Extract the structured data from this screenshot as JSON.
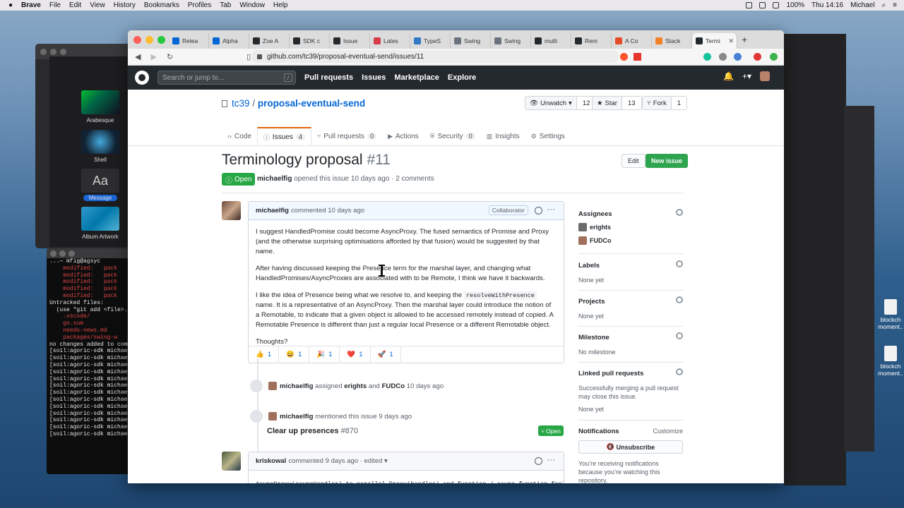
{
  "menubar": {
    "app": "Brave",
    "items": [
      "File",
      "Edit",
      "View",
      "History",
      "Bookmarks",
      "Profiles",
      "Tab",
      "Window",
      "Help"
    ],
    "battery": "100%",
    "clock": "Thu 14:16",
    "user": "Michael"
  },
  "left_window": {
    "thumbs": [
      "Arabesque",
      "Shell",
      "Message",
      "Album Artwork"
    ],
    "aa": "Aa"
  },
  "terminal": {
    "lines": [
      {
        "t": "...— mfig@agsyc",
        "c": "w"
      },
      {
        "t": "    modified:   pack",
        "c": "r"
      },
      {
        "t": "    modified:   pack",
        "c": "r"
      },
      {
        "t": "    modified:   pack",
        "c": "r"
      },
      {
        "t": "    modified:   pack",
        "c": "r"
      },
      {
        "t": "    modified:   pack",
        "c": "r"
      },
      {
        "t": "",
        "c": "w"
      },
      {
        "t": "Untracked files:",
        "c": "w"
      },
      {
        "t": "  (use \"git add <file>...",
        "c": "w"
      },
      {
        "t": "    .vscode/",
        "c": "r"
      },
      {
        "t": "    go.sum",
        "c": "r"
      },
      {
        "t": "    needs-news.md",
        "c": "r"
      },
      {
        "t": "    packages/swing-w",
        "c": "r"
      },
      {
        "t": "",
        "c": "w"
      },
      {
        "t": "no changes added to comm",
        "c": "w"
      },
      {
        "t": "[soil:agoric-sdk michaelf",
        "c": "w"
      },
      {
        "t": "[soil:agoric-sdk michaelf",
        "c": "w"
      },
      {
        "t": "[soil:agoric-sdk michaelf",
        "c": "w"
      },
      {
        "t": "[soil:agoric-sdk michaelf",
        "c": "w"
      },
      {
        "t": "[soil:agoric-sdk michaelf",
        "c": "w"
      },
      {
        "t": "[soil:agoric-sdk michaelf",
        "c": "w"
      },
      {
        "t": "[soil:agoric-sdk michaelf",
        "c": "w"
      },
      {
        "t": "[soil:agoric-sdk michaelf",
        "c": "w"
      },
      {
        "t": "[soil:agoric-sdk michaelf",
        "c": "w"
      },
      {
        "t": "[soil:agoric-sdk michaelf",
        "c": "w"
      },
      {
        "t": "[soil:agoric-sdk michaelf",
        "c": "w"
      },
      {
        "t": "[soil:agoric-sdk michaelf",
        "c": "w"
      },
      {
        "t": "[soil:agoric-sdk michaelf",
        "c": "w"
      }
    ]
  },
  "desktop_icons": [
    "blockch moment..",
    "blockch moment.."
  ],
  "browser": {
    "tabs": [
      {
        "label": "Relea",
        "color": "#0366d6"
      },
      {
        "label": "Alpha",
        "color": "#0366d6"
      },
      {
        "label": "Zoe A",
        "color": "#24292e"
      },
      {
        "label": "SDK c",
        "color": "#24292e"
      },
      {
        "label": "Issue",
        "color": "#24292e"
      },
      {
        "label": "Lates",
        "color": "#d73a49"
      },
      {
        "label": "TypeS",
        "color": "#3178c6"
      },
      {
        "label": "Swing",
        "color": "#6a737d"
      },
      {
        "label": "Swing",
        "color": "#6a737d"
      },
      {
        "label": "multi",
        "color": "#24292e"
      },
      {
        "label": "Rem",
        "color": "#24292e"
      },
      {
        "label": "A Co",
        "color": "#e34c26"
      },
      {
        "label": "Stack",
        "color": "#f48024"
      },
      {
        "label": "Termi",
        "color": "#24292e"
      }
    ],
    "url": "github.com/tc39/proposal-eventual-send/issues/11"
  },
  "gh": {
    "search_placeholder": "Search or jump to...",
    "nav": [
      "Pull requests",
      "Issues",
      "Marketplace",
      "Explore"
    ],
    "owner": "tc39",
    "slash": "/",
    "repo": "proposal-eventual-send",
    "watch": {
      "label": "Unwatch",
      "count": "12"
    },
    "star": {
      "label": "Star",
      "count": "13"
    },
    "fork": {
      "label": "Fork",
      "count": "1"
    },
    "tabs": [
      {
        "label": "Code",
        "count": ""
      },
      {
        "label": "Issues",
        "count": "4"
      },
      {
        "label": "Pull requests",
        "count": "0"
      },
      {
        "label": "Actions",
        "count": ""
      },
      {
        "label": "Security",
        "count": "0"
      },
      {
        "label": "Insights",
        "count": ""
      },
      {
        "label": "Settings",
        "count": ""
      }
    ],
    "issue": {
      "title": "Terminology proposal",
      "number": "#11",
      "state": "Open",
      "author": "michaelfig",
      "meta": "opened this issue 10 days ago · 2 comments",
      "edit": "Edit",
      "new_issue": "New issue"
    },
    "comment1": {
      "author": "michaelfig",
      "meta": "commented 10 days ago",
      "role": "Collaborator",
      "p1": "I suggest HandledPromise could become AsyncProxy. The fused semantics of Promise and Proxy (and the otherwise surprising optimisations afforded by that fusion) would be suggested by that name.",
      "p2": "After having discussed keeping the Presence term for the marshal layer, and changing what HandledPromises/AsyncProxies are associated with to be Remote, I think we have it backwards.",
      "p3a": "I like the idea of Presence being what we resolve to, and keeping the",
      "p3code": "resolveWithPresence",
      "p3b": "name. It is a representative of an AsyncProxy. Then the marshal layer could introduce the notion of a Remotable, to indicate that a given object is allowed to be accessed remotely instead of copied. A Remotable Presence is different than just a regular local Presence or a different Remotable object.",
      "p4": "Thoughts?",
      "reactions": [
        {
          "emoji": "👍",
          "count": "1"
        },
        {
          "emoji": "😄",
          "count": "1"
        },
        {
          "emoji": "🎉",
          "count": "1"
        },
        {
          "emoji": "❤️",
          "count": "1"
        },
        {
          "emoji": "🚀",
          "count": "1"
        }
      ]
    },
    "event1": {
      "actor": "michaelfig",
      "verb": "assigned",
      "a1": "erights",
      "and": "and",
      "a2": "FUDCo",
      "time": "10 days ago"
    },
    "event2": {
      "actor": "michaelfig",
      "text": "mentioned this issue 9 days ago",
      "ref_title": "Clear up presences",
      "ref_num": "#870",
      "ref_state": "Open"
    },
    "comment2": {
      "author": "kriskowal",
      "meta": "commented 9 days ago · edited ▾",
      "preview": "AsyncProxy(asyncHandler) to parallel Proxy(handler) and function / async function feels like"
    },
    "sidebar": {
      "assignees": {
        "h": "Assignees",
        "items": [
          "erights",
          "FUDCo"
        ]
      },
      "labels": {
        "h": "Labels",
        "v": "None yet"
      },
      "projects": {
        "h": "Projects",
        "v": "None yet"
      },
      "milestone": {
        "h": "Milestone",
        "v": "No milestone"
      },
      "linked": {
        "h": "Linked pull requests",
        "v": "Successfully merging a pull request may close this issue.",
        "v2": "None yet"
      },
      "notifications": {
        "h": "Notifications",
        "customize": "Customize",
        "button": "Unsubscribe",
        "note": "You’re receiving notifications because you’re watching this repository."
      }
    }
  },
  "colors": {
    "accent": "#0366d6",
    "open_green": "#28a745",
    "header": "#24292e",
    "tab_orange": "#e36209"
  }
}
